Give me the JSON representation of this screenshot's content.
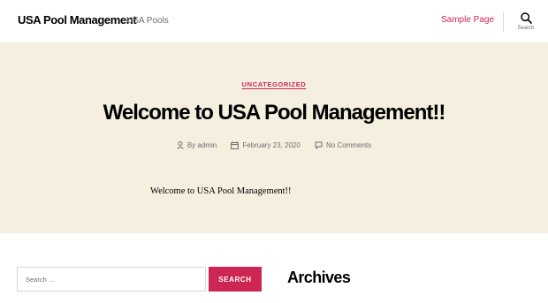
{
  "header": {
    "site_title": "USA Pool Management",
    "site_description": "USA Pools",
    "nav": [
      {
        "label": "Sample Page"
      }
    ],
    "search_toggle_label": "Search"
  },
  "post": {
    "category": "UNCATEGORIZED",
    "title": "Welcome to USA Pool Management!!",
    "meta": {
      "author": "By admin",
      "date": "February 23, 2020",
      "comments": "No Comments"
    },
    "content": "Welcome to USA Pool Management!!"
  },
  "widgets": {
    "search": {
      "placeholder": "Search …",
      "button_label": "SEARCH"
    },
    "archives_title": "Archives"
  },
  "colors": {
    "accent": "#cd2653",
    "hero_background": "#f5efe0",
    "secondary_text": "#6d6d6d"
  },
  "icons": [
    "search-icon",
    "author-icon",
    "calendar-icon",
    "comment-icon"
  ]
}
